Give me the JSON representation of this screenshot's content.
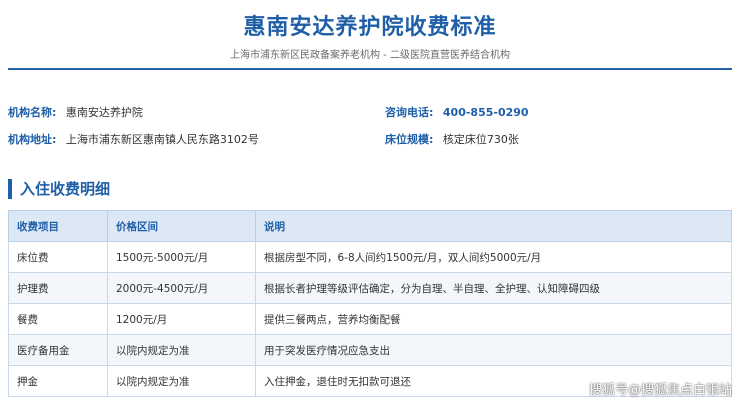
{
  "header": {
    "title": "惠南安达养护院收费标准",
    "subtitle": "上海市浦东新区民政备案养老机构 - 二级医院直营医养结合机构"
  },
  "info": {
    "name_label": "机构名称:",
    "name_value": "惠南安达养护院",
    "phone_label": "咨询电话:",
    "phone_value": "400-855-0290",
    "address_label": "机构地址:",
    "address_value": "上海市浦东新区惠南镇人民东路3102号",
    "beds_label": "床位规模:",
    "beds_value": "核定床位730张"
  },
  "section": {
    "title": "入住收费明细"
  },
  "table": {
    "headers": [
      "收费项目",
      "价格区间",
      "说明"
    ],
    "rows": [
      [
        "床位费",
        "1500元-5000元/月",
        "根据房型不同，6-8人间约1500元/月，双人间约5000元/月"
      ],
      [
        "护理费",
        "2000元-4500元/月",
        "根据长者护理等级评估确定，分为自理、半自理、全护理、认知障碍四级"
      ],
      [
        "餐费",
        "1200元/月",
        "提供三餐两点，营养均衡配餐"
      ],
      [
        "医疗备用金",
        "以院内规定为准",
        "用于突发医疗情况应急支出"
      ],
      [
        "押金",
        "以院内规定为准",
        "入住押金，退住时无扣款可退还"
      ]
    ]
  },
  "watermark": "搜狐号@搜狐焦点白银站"
}
